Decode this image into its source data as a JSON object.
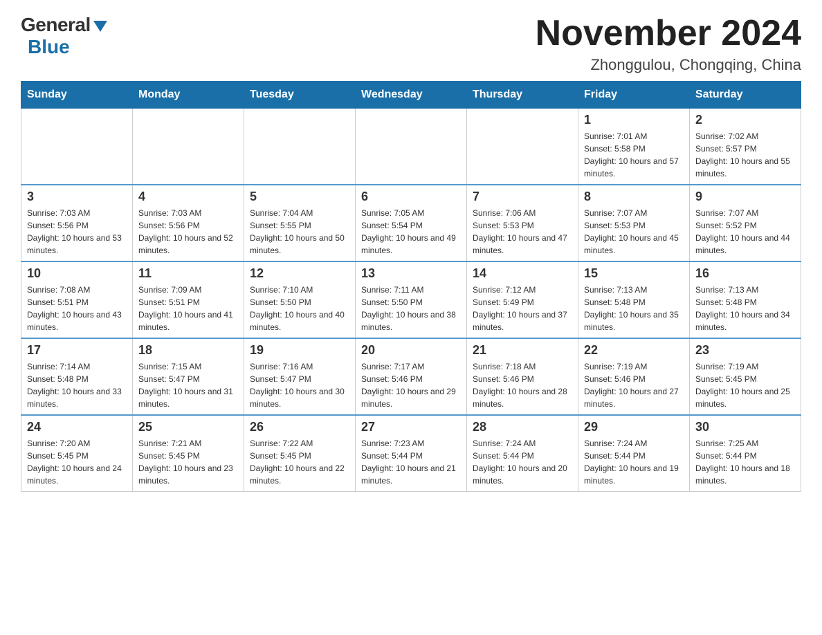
{
  "logo": {
    "general": "General",
    "blue": "Blue"
  },
  "title": {
    "month": "November 2024",
    "location": "Zhonggulou, Chongqing, China"
  },
  "weekdays": [
    "Sunday",
    "Monday",
    "Tuesday",
    "Wednesday",
    "Thursday",
    "Friday",
    "Saturday"
  ],
  "weeks": [
    [
      {
        "day": "",
        "info": ""
      },
      {
        "day": "",
        "info": ""
      },
      {
        "day": "",
        "info": ""
      },
      {
        "day": "",
        "info": ""
      },
      {
        "day": "",
        "info": ""
      },
      {
        "day": "1",
        "info": "Sunrise: 7:01 AM\nSunset: 5:58 PM\nDaylight: 10 hours and 57 minutes."
      },
      {
        "day": "2",
        "info": "Sunrise: 7:02 AM\nSunset: 5:57 PM\nDaylight: 10 hours and 55 minutes."
      }
    ],
    [
      {
        "day": "3",
        "info": "Sunrise: 7:03 AM\nSunset: 5:56 PM\nDaylight: 10 hours and 53 minutes."
      },
      {
        "day": "4",
        "info": "Sunrise: 7:03 AM\nSunset: 5:56 PM\nDaylight: 10 hours and 52 minutes."
      },
      {
        "day": "5",
        "info": "Sunrise: 7:04 AM\nSunset: 5:55 PM\nDaylight: 10 hours and 50 minutes."
      },
      {
        "day": "6",
        "info": "Sunrise: 7:05 AM\nSunset: 5:54 PM\nDaylight: 10 hours and 49 minutes."
      },
      {
        "day": "7",
        "info": "Sunrise: 7:06 AM\nSunset: 5:53 PM\nDaylight: 10 hours and 47 minutes."
      },
      {
        "day": "8",
        "info": "Sunrise: 7:07 AM\nSunset: 5:53 PM\nDaylight: 10 hours and 45 minutes."
      },
      {
        "day": "9",
        "info": "Sunrise: 7:07 AM\nSunset: 5:52 PM\nDaylight: 10 hours and 44 minutes."
      }
    ],
    [
      {
        "day": "10",
        "info": "Sunrise: 7:08 AM\nSunset: 5:51 PM\nDaylight: 10 hours and 43 minutes."
      },
      {
        "day": "11",
        "info": "Sunrise: 7:09 AM\nSunset: 5:51 PM\nDaylight: 10 hours and 41 minutes."
      },
      {
        "day": "12",
        "info": "Sunrise: 7:10 AM\nSunset: 5:50 PM\nDaylight: 10 hours and 40 minutes."
      },
      {
        "day": "13",
        "info": "Sunrise: 7:11 AM\nSunset: 5:50 PM\nDaylight: 10 hours and 38 minutes."
      },
      {
        "day": "14",
        "info": "Sunrise: 7:12 AM\nSunset: 5:49 PM\nDaylight: 10 hours and 37 minutes."
      },
      {
        "day": "15",
        "info": "Sunrise: 7:13 AM\nSunset: 5:48 PM\nDaylight: 10 hours and 35 minutes."
      },
      {
        "day": "16",
        "info": "Sunrise: 7:13 AM\nSunset: 5:48 PM\nDaylight: 10 hours and 34 minutes."
      }
    ],
    [
      {
        "day": "17",
        "info": "Sunrise: 7:14 AM\nSunset: 5:48 PM\nDaylight: 10 hours and 33 minutes."
      },
      {
        "day": "18",
        "info": "Sunrise: 7:15 AM\nSunset: 5:47 PM\nDaylight: 10 hours and 31 minutes."
      },
      {
        "day": "19",
        "info": "Sunrise: 7:16 AM\nSunset: 5:47 PM\nDaylight: 10 hours and 30 minutes."
      },
      {
        "day": "20",
        "info": "Sunrise: 7:17 AM\nSunset: 5:46 PM\nDaylight: 10 hours and 29 minutes."
      },
      {
        "day": "21",
        "info": "Sunrise: 7:18 AM\nSunset: 5:46 PM\nDaylight: 10 hours and 28 minutes."
      },
      {
        "day": "22",
        "info": "Sunrise: 7:19 AM\nSunset: 5:46 PM\nDaylight: 10 hours and 27 minutes."
      },
      {
        "day": "23",
        "info": "Sunrise: 7:19 AM\nSunset: 5:45 PM\nDaylight: 10 hours and 25 minutes."
      }
    ],
    [
      {
        "day": "24",
        "info": "Sunrise: 7:20 AM\nSunset: 5:45 PM\nDaylight: 10 hours and 24 minutes."
      },
      {
        "day": "25",
        "info": "Sunrise: 7:21 AM\nSunset: 5:45 PM\nDaylight: 10 hours and 23 minutes."
      },
      {
        "day": "26",
        "info": "Sunrise: 7:22 AM\nSunset: 5:45 PM\nDaylight: 10 hours and 22 minutes."
      },
      {
        "day": "27",
        "info": "Sunrise: 7:23 AM\nSunset: 5:44 PM\nDaylight: 10 hours and 21 minutes."
      },
      {
        "day": "28",
        "info": "Sunrise: 7:24 AM\nSunset: 5:44 PM\nDaylight: 10 hours and 20 minutes."
      },
      {
        "day": "29",
        "info": "Sunrise: 7:24 AM\nSunset: 5:44 PM\nDaylight: 10 hours and 19 minutes."
      },
      {
        "day": "30",
        "info": "Sunrise: 7:25 AM\nSunset: 5:44 PM\nDaylight: 10 hours and 18 minutes."
      }
    ]
  ]
}
